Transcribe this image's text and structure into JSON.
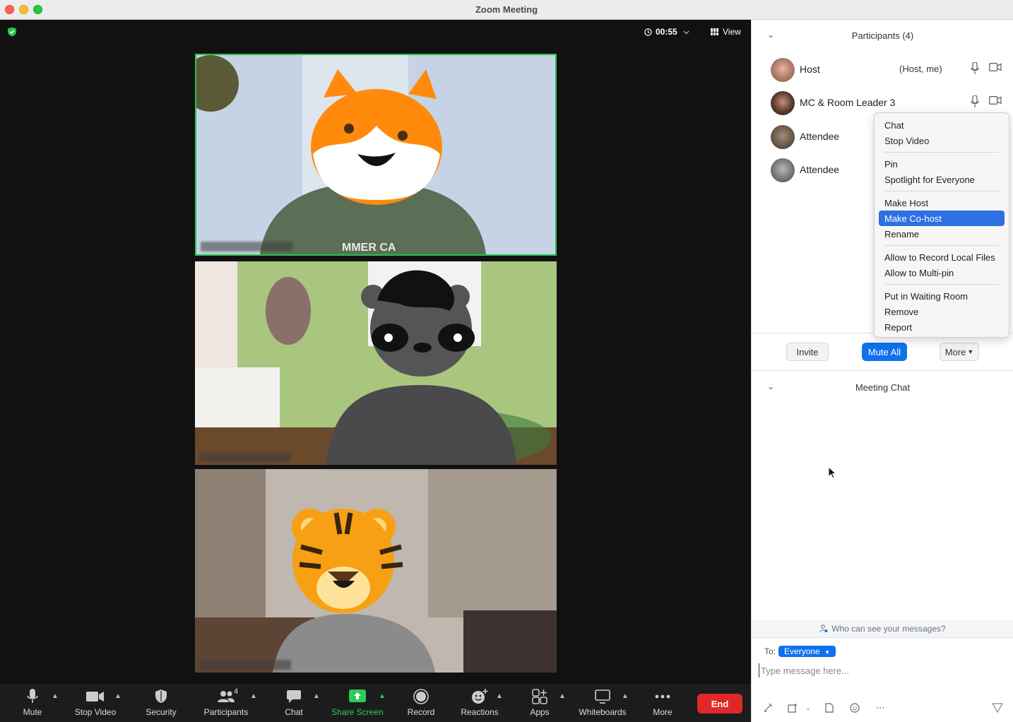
{
  "window": {
    "title": "Zoom Meeting"
  },
  "meeting": {
    "timer": "00:55",
    "view_label": "View"
  },
  "toolbar": {
    "mute": "Mute",
    "stop_video": "Stop Video",
    "security": "Security",
    "participants": "Participants",
    "participants_count": "4",
    "chat": "Chat",
    "share_screen": "Share Screen",
    "record": "Record",
    "reactions": "Reactions",
    "apps": "Apps",
    "whiteboards": "Whiteboards",
    "more": "More",
    "end": "End"
  },
  "participants_panel": {
    "title": "Participants (4)",
    "participants": [
      {
        "name": "Host",
        "role": "(Host, me)"
      },
      {
        "name": "MC & Room Leader 3",
        "role": ""
      },
      {
        "name": "Attendee",
        "role": ""
      },
      {
        "name": "Attendee",
        "role": ""
      }
    ],
    "invite": "Invite",
    "mute_all": "Mute All",
    "more": "More"
  },
  "context_menu": {
    "groups": [
      [
        "Chat",
        "Stop Video"
      ],
      [
        "Pin",
        "Spotlight for Everyone"
      ],
      [
        "Make Host",
        "Make Co-host",
        "Rename"
      ],
      [
        "Allow to Record Local Files",
        "Allow to Multi-pin"
      ],
      [
        "Put in Waiting Room",
        "Remove",
        "Report"
      ]
    ],
    "selected": "Make Co-host"
  },
  "chat_panel": {
    "title": "Meeting Chat",
    "who_can_see": "Who can see your messages?",
    "to_label": "To:",
    "to_value": "Everyone",
    "placeholder": "Type message here..."
  },
  "colors": {
    "accent": "#0e72ed",
    "end": "#e02828",
    "share": "#2ecc55",
    "active_speaker": "#27c24c"
  }
}
